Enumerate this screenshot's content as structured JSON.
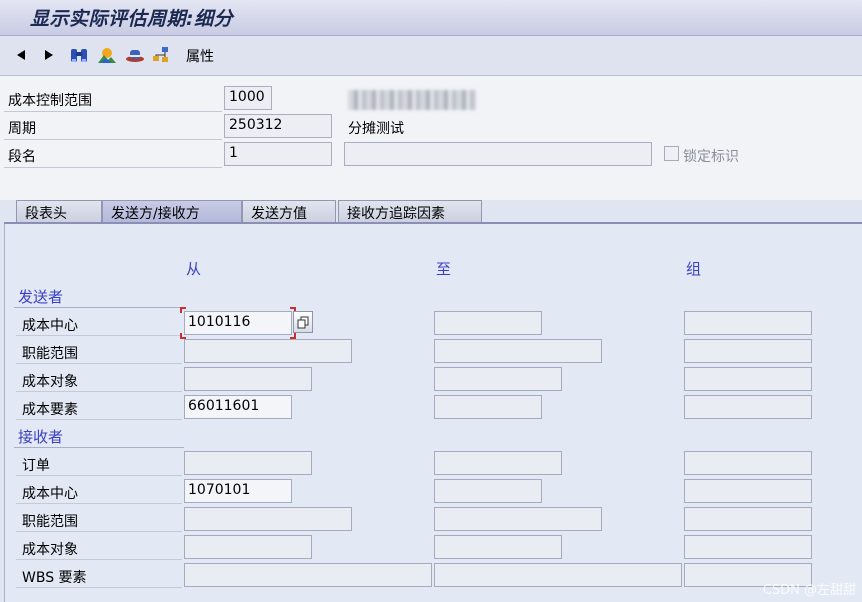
{
  "title": "显示实际评估周期:细分",
  "toolbar": {
    "attributes_label": "属性"
  },
  "header": {
    "controlling_area_label": "成本控制范围",
    "controlling_area_value": "1000",
    "period_label": "周期",
    "period_value": "250312",
    "cycle_text": "分摊测试",
    "segment_label": "段名",
    "segment_value": "1",
    "segment_text": "",
    "lock_label": "锁定标识"
  },
  "tabs": [
    "段表头",
    "发送方/接收方",
    "发送方值",
    "接收方追踪因素"
  ],
  "columns": {
    "from": "从",
    "to": "至",
    "group": "组"
  },
  "sender": {
    "title": "发送者",
    "rows": [
      {
        "label": "成本中心",
        "from": "1010116",
        "to": "",
        "group": ""
      },
      {
        "label": "职能范围",
        "from": "",
        "to": "",
        "group": ""
      },
      {
        "label": "成本对象",
        "from": "",
        "to": "",
        "group": ""
      },
      {
        "label": "成本要素",
        "from": "66011601",
        "to": "",
        "group": ""
      }
    ]
  },
  "receiver": {
    "title": "接收者",
    "rows": [
      {
        "label": "订单",
        "from": "",
        "to": "",
        "group": ""
      },
      {
        "label": "成本中心",
        "from": "1070101",
        "to": "",
        "group": ""
      },
      {
        "label": "职能范围",
        "from": "",
        "to": "",
        "group": ""
      },
      {
        "label": "成本对象",
        "from": "",
        "to": "",
        "group": ""
      },
      {
        "label": "WBS 要素",
        "from": "",
        "to": "",
        "group": ""
      }
    ]
  },
  "watermark": "CSDN @左甜甜"
}
